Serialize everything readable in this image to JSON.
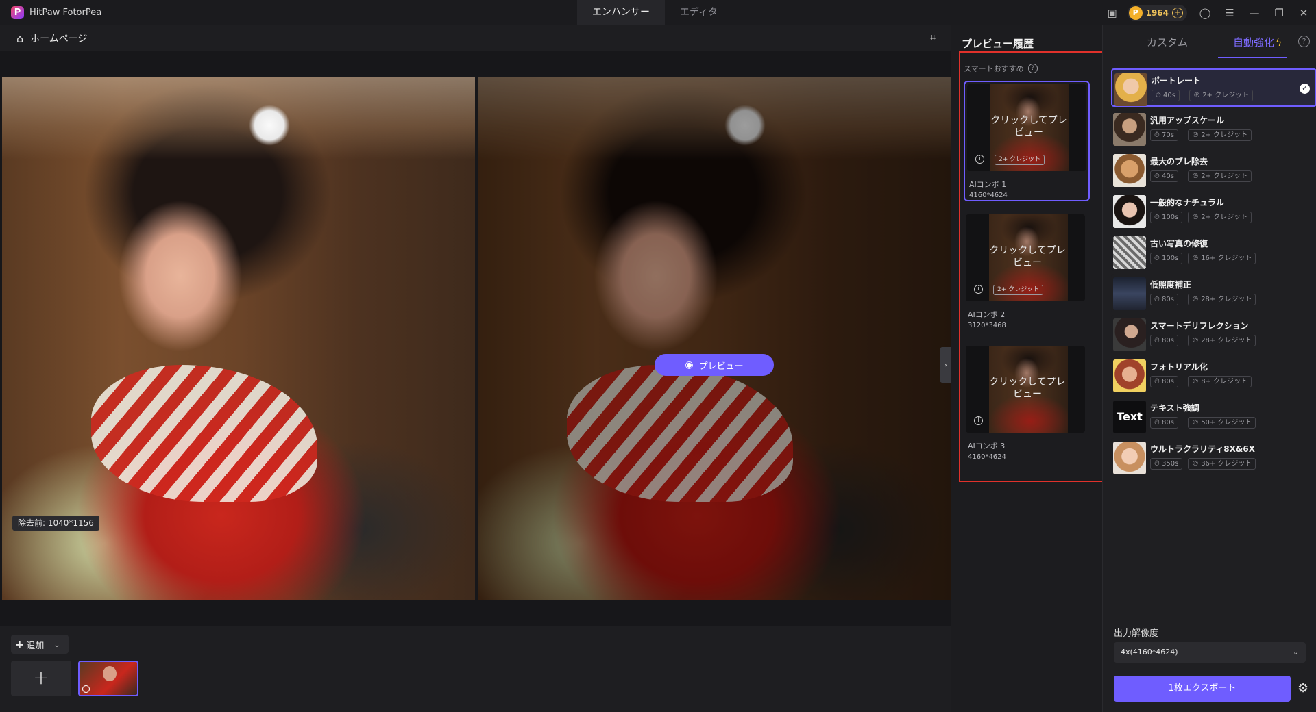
{
  "app": {
    "name": "HitPaw FotorPea",
    "logo_letter": "P"
  },
  "mode_tabs": [
    {
      "label": "エンハンサー",
      "active": true
    },
    {
      "label": "エディタ",
      "active": false
    }
  ],
  "titlebar": {
    "credits": "1964"
  },
  "workspace": {
    "home_label": "ホームページ",
    "before_size": "除去前: 1040*1156",
    "preview_button": "プレビュー"
  },
  "bottom": {
    "add_label": "追加"
  },
  "history": {
    "title": "プレビュー履歴",
    "smart_label": "スマートおすすめ",
    "cards": [
      {
        "overlay": "クリックしてプレビュー",
        "credit": "2+ クレジット",
        "name": "AIコンボ 1",
        "dims": "4160*4624",
        "active": true
      },
      {
        "overlay": "クリックしてプレビュー",
        "credit": "2+ クレジット",
        "name": "AIコンボ 2",
        "dims": "3120*3468",
        "active": false
      },
      {
        "overlay": "クリックしてプレビュー",
        "credit": "",
        "name": "AIコンボ 3",
        "dims": "4160*4624",
        "active": false
      }
    ]
  },
  "rpanel": {
    "tab_custom": "カスタム",
    "tab_auto": "自動強化",
    "models": [
      {
        "name": "ポートレート",
        "time": "40s",
        "credit": "2+ クレジット",
        "thumb": "th-a",
        "selected": true
      },
      {
        "name": "汎用アップスケール",
        "time": "70s",
        "credit": "2+ クレジット",
        "thumb": "th-b"
      },
      {
        "name": "最大のブレ除去",
        "time": "40s",
        "credit": "2+ クレジット",
        "thumb": "th-c"
      },
      {
        "name": "一般的なナチュラル",
        "time": "100s",
        "credit": "2+ クレジット",
        "thumb": "th-d"
      },
      {
        "name": "古い写真の修復",
        "time": "100s",
        "credit": "16+ クレジット",
        "thumb": "th-e"
      },
      {
        "name": "低照度補正",
        "time": "80s",
        "credit": "28+ クレジット",
        "thumb": "th-f"
      },
      {
        "name": "スマートデリフレクション",
        "time": "80s",
        "credit": "28+ クレジット",
        "thumb": "th-g"
      },
      {
        "name": "フォトリアル化",
        "time": "80s",
        "credit": "8+ クレジット",
        "thumb": "th-h"
      },
      {
        "name": "テキスト強調",
        "time": "80s",
        "credit": "50+ クレジット",
        "thumb": "th-i",
        "thumb_text": "Text"
      },
      {
        "name": "ウルトラクラリティ8X&6X",
        "time": "350s",
        "credit": "36+ クレジット",
        "thumb": "th-j"
      }
    ],
    "output_label": "出力解像度",
    "output_value": "4x(4160*4624)",
    "export_label": "1枚エクスポート"
  },
  "colors": {
    "accent": "#6f5dff",
    "highlight_frame": "#e0312b",
    "credit_gold": "#f0c35a"
  }
}
